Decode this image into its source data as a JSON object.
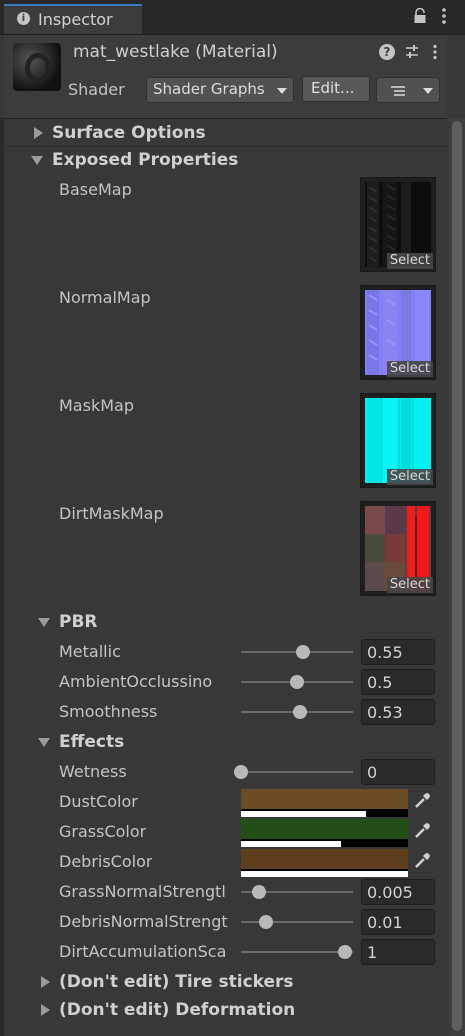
{
  "tab": {
    "title": "Inspector",
    "icon": "info-icon"
  },
  "header": {
    "material_name": "mat_westlake (Material)",
    "shader_label": "Shader",
    "shader_value": "Shader Graphs",
    "edit_label": "Edit...",
    "icons": [
      "help-icon",
      "settings-icon",
      "kebab-icon",
      "list-icon"
    ]
  },
  "sections": {
    "surface_options": "Surface Options",
    "exposed_properties": "Exposed Properties",
    "pbr": "PBR",
    "effects": "Effects",
    "tire_stickers": "(Don't edit) Tire stickers",
    "deformation": "(Don't edit) Deformation"
  },
  "textures": [
    {
      "label": "BaseMap",
      "select": "Select"
    },
    {
      "label": "NormalMap",
      "select": "Select"
    },
    {
      "label": "MaskMap",
      "select": "Select"
    },
    {
      "label": "DirtMaskMap",
      "select": "Select"
    }
  ],
  "pbr": [
    {
      "label": "Metallic",
      "value": "0.55",
      "fraction": 0.55
    },
    {
      "label": "AmbientOcclussino",
      "value": "0.5",
      "fraction": 0.5
    },
    {
      "label": "Smoothness",
      "value": "0.53",
      "fraction": 0.53
    }
  ],
  "effects": {
    "wetness": {
      "label": "Wetness",
      "value": "0",
      "fraction": 0.0
    },
    "colors": [
      {
        "label": "DustColor",
        "color": "#6b4c24",
        "alpha": 0.75
      },
      {
        "label": "GrassColor",
        "color": "#244e18",
        "alpha": 0.6
      },
      {
        "label": "DebrisColor",
        "color": "#5e3e1c",
        "alpha": 1.0
      }
    ],
    "grass_normal": {
      "label": "GrassNormalStrengtl",
      "value": "0.005",
      "fraction": 0.16
    },
    "debris_normal": {
      "label": "DebrisNormalStrengt",
      "value": "0.01",
      "fraction": 0.22
    },
    "dirt_accum": {
      "label": "DirtAccumulationSca",
      "value": "1",
      "fraction": 0.93
    }
  }
}
